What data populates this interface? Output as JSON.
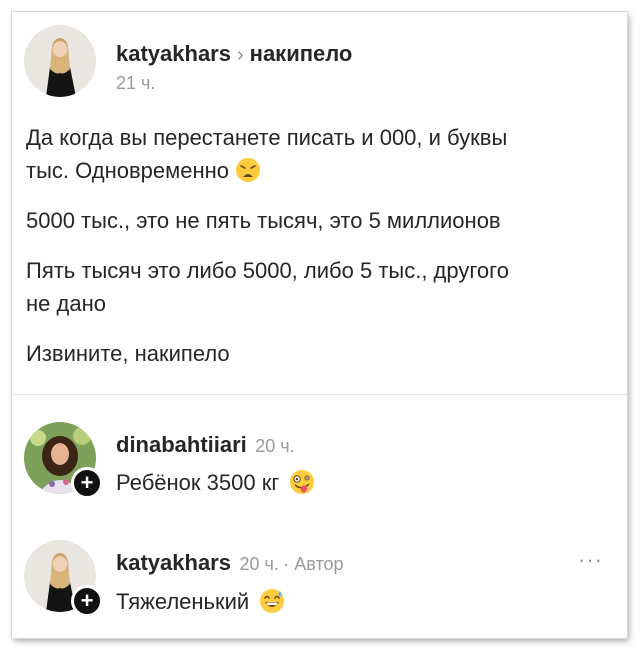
{
  "post": {
    "author": "katyakhars",
    "separator": "›",
    "community": "накипело",
    "time": "21 ч.",
    "paragraphs": [
      "Да когда вы перестанете писать и 000, и буквы",
      "тыс. Одновременно",
      "5000 тыс., это не пять тысяч, это 5 миллионов",
      "Пять тысяч это либо 5000, либо 5 тыс., другого",
      "не дано",
      "Извините, накипело"
    ],
    "emoji_1": "weary-face-emoji"
  },
  "comments": [
    {
      "author": "dinabahtiiari",
      "time": "20 ч.",
      "text": "Ребёнок 3500 кг",
      "emoji": "zany-face-emoji"
    },
    {
      "author": "katyakhars",
      "time": "20 ч.",
      "role": "· Автор",
      "text": "Тяжеленький",
      "emoji": "grinning-sweat-emoji",
      "more": "···"
    }
  ],
  "colors": {
    "text": "#262626",
    "muted": "#9a9a9a",
    "divider": "#e4e4e4"
  }
}
